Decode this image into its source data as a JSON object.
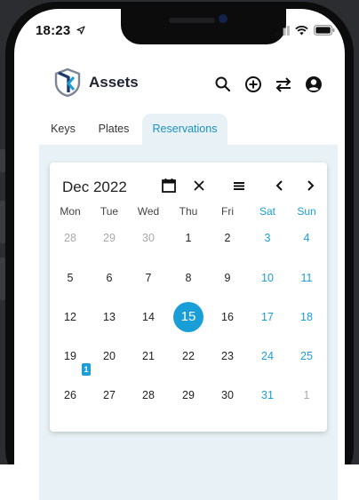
{
  "status_bar": {
    "time": "18:23"
  },
  "app": {
    "title": "Assets"
  },
  "tabs": [
    {
      "label": "Keys"
    },
    {
      "label": "Plates"
    },
    {
      "label": "Reservations",
      "active": true
    }
  ],
  "calendar": {
    "month_label": "Dec 2022",
    "weekdays": [
      "Mon",
      "Tue",
      "Wed",
      "Thu",
      "Fri",
      "Sat",
      "Sun"
    ],
    "weeks": [
      [
        "28",
        "29",
        "30",
        "1",
        "2",
        "3",
        "4"
      ],
      [
        "5",
        "6",
        "7",
        "8",
        "9",
        "10",
        "11"
      ],
      [
        "12",
        "13",
        "14",
        "15",
        "16",
        "17",
        "18"
      ],
      [
        "19",
        "20",
        "21",
        "22",
        "23",
        "24",
        "25"
      ],
      [
        "26",
        "27",
        "28",
        "29",
        "30",
        "31",
        "1"
      ]
    ],
    "today": "15",
    "reservation_badge": {
      "day": "19",
      "count": "1"
    }
  },
  "colors": {
    "accent": "#1a9ed8",
    "content_bg": "#e8f2f6",
    "text": "#222222",
    "muted_text": "#a9a9a9"
  },
  "icons": [
    "search-icon",
    "add-circle-icon",
    "swap-icon",
    "account-icon",
    "calendar-icon",
    "close-icon",
    "menu-icon",
    "chevron-left-icon",
    "chevron-right-icon"
  ]
}
